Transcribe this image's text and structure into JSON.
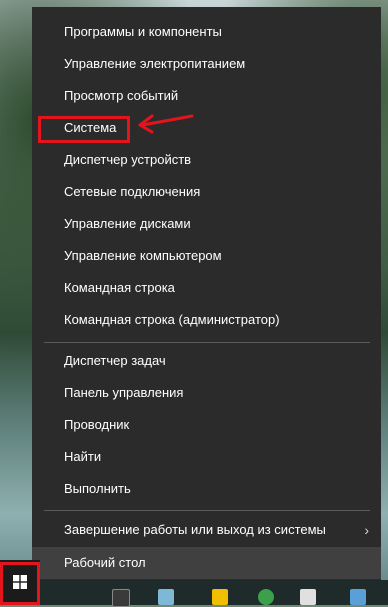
{
  "menu": {
    "items": [
      {
        "label": "Программы и компоненты"
      },
      {
        "label": "Управление электропитанием"
      },
      {
        "label": "Просмотр событий"
      },
      {
        "label": "Система"
      },
      {
        "label": "Диспетчер устройств"
      },
      {
        "label": "Сетевые подключения"
      },
      {
        "label": "Управление дисками"
      },
      {
        "label": "Управление компьютером"
      },
      {
        "label": "Командная строка"
      },
      {
        "label": "Командная строка (администратор)"
      },
      {
        "label": "Диспетчер задач"
      },
      {
        "label": "Панель управления"
      },
      {
        "label": "Проводник"
      },
      {
        "label": "Найти"
      },
      {
        "label": "Выполнить"
      },
      {
        "label": "Завершение работы или выход из системы",
        "submenu_glyph": "›"
      },
      {
        "label": "Рабочий стол"
      }
    ],
    "hovered_item": "Рабочий стол",
    "highlighted_item": "Система"
  },
  "taskbar": {
    "start_icon": "windows-logo-icon"
  },
  "colors": {
    "menu_bg": "#2b2b2b",
    "hover_bg": "#404040",
    "annotation_red": "#e3141b",
    "text": "#ffffff"
  }
}
